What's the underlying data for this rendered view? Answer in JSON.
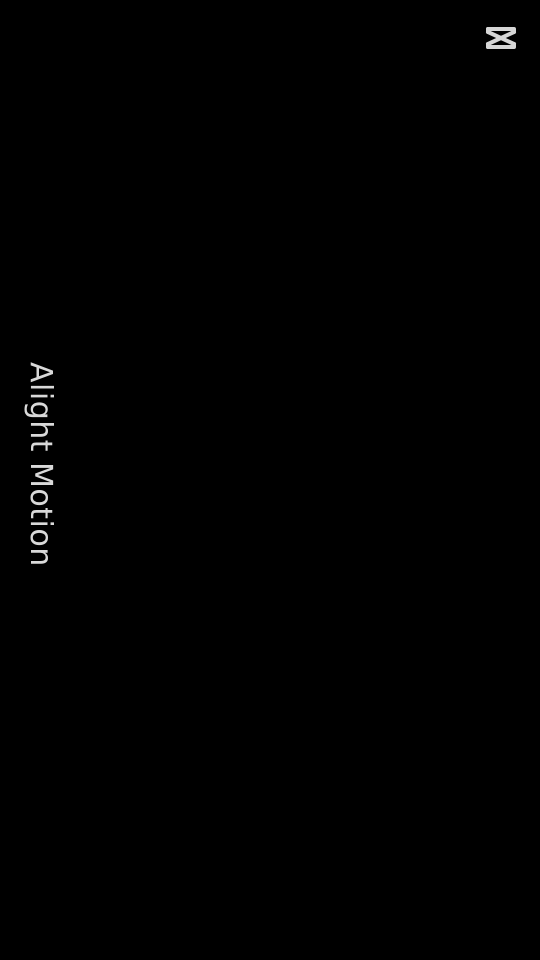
{
  "overlay": {
    "logo_icon": "capcut-logo-icon",
    "watermark_text": "Alight Motion",
    "background_color": "#000000",
    "watermark_color": "#d9d9d9"
  }
}
